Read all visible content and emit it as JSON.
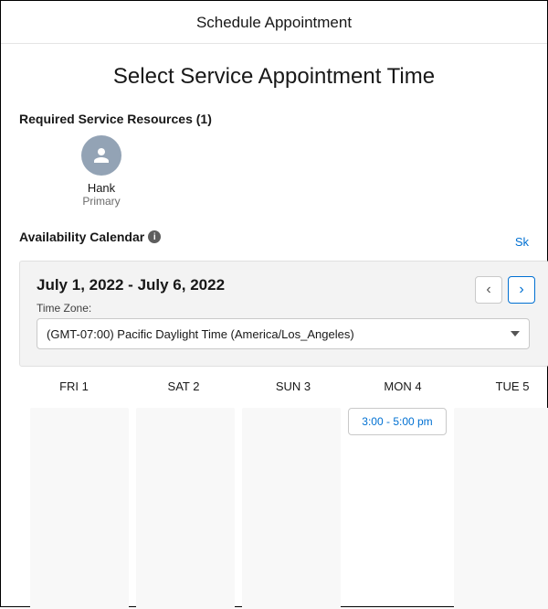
{
  "header": {
    "title": "Schedule Appointment"
  },
  "subtitle": "Select Service Appointment Time",
  "resources": {
    "label": "Required Service Resources (1)",
    "items": [
      {
        "name": "Hank",
        "role": "Primary"
      }
    ]
  },
  "availability": {
    "label": "Availability Calendar",
    "skip_label": "Sk",
    "date_range": "July 1, 2022 - July 6, 2022",
    "timezone_label": "Time Zone:",
    "timezone_value": "(GMT-07:00) Pacific Daylight Time (America/Los_Angeles)"
  },
  "days": [
    {
      "label": "FRI 1",
      "slots": []
    },
    {
      "label": "SAT 2",
      "slots": []
    },
    {
      "label": "SUN 3",
      "slots": []
    },
    {
      "label": "MON 4",
      "slots": [
        "3:00 - 5:00 pm"
      ]
    },
    {
      "label": "TUE 5",
      "slots": []
    }
  ]
}
